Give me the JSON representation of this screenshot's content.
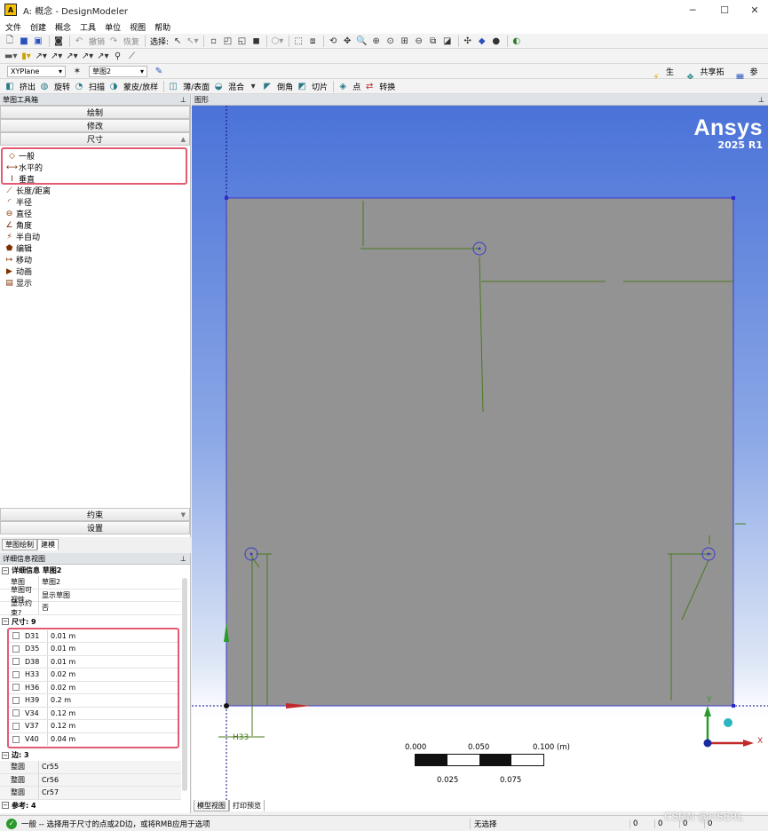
{
  "window": {
    "title": "A: 概念 - DesignModeler",
    "app_icon": "A",
    "minimize": "─",
    "maximize": "☐",
    "close": "✕"
  },
  "menubar": [
    "文件",
    "创建",
    "概念",
    "工具",
    "单位",
    "视图",
    "帮助"
  ],
  "toolbar1": {
    "undo": "撤销",
    "redo": "恢复",
    "select_label": "选择:"
  },
  "toolbar3": {
    "plane": "XYPlane",
    "sketch": "草图2",
    "generate": "生成",
    "share_topology": "共享拓扑",
    "parameters": "参数"
  },
  "toolbar4": {
    "items": [
      "挤出",
      "旋转",
      "扫描",
      "蒙皮/放样",
      "薄/表面",
      "混合",
      "倒角",
      "切片",
      "点",
      "转换"
    ]
  },
  "sketch_toolbox": {
    "title": "草图工具箱",
    "sections": {
      "draw": "绘制",
      "modify": "修改",
      "dimension": "尺寸",
      "constraint": "约束",
      "settings": "设置"
    },
    "tools": [
      "一般",
      "水平的",
      "垂直",
      "长度/距离",
      "半径",
      "直径",
      "角度",
      "半自动",
      "编辑",
      "移动",
      "动画",
      "显示"
    ]
  },
  "tabs": {
    "sketching": "草图绘制",
    "modeling": "建模"
  },
  "details": {
    "title": "详细信息视图",
    "header": "详细信息 草图2",
    "rows": [
      {
        "k": "草图",
        "v": "草图2"
      },
      {
        "k": "草图可视性",
        "v": "显示草图"
      },
      {
        "k": "显示约束?",
        "v": "否"
      }
    ],
    "dims_header": "尺寸: 9",
    "dims": [
      {
        "k": "D31",
        "v": "0.01 m"
      },
      {
        "k": "D35",
        "v": "0.01 m"
      },
      {
        "k": "D38",
        "v": "0.01 m"
      },
      {
        "k": "H33",
        "v": "0.02 m"
      },
      {
        "k": "H36",
        "v": "0.02 m"
      },
      {
        "k": "H39",
        "v": "0.2 m"
      },
      {
        "k": "V34",
        "v": "0.12 m"
      },
      {
        "k": "V37",
        "v": "0.12 m"
      },
      {
        "k": "V40",
        "v": "0.04 m"
      }
    ],
    "edges_header": "边: 3",
    "edges": [
      {
        "k": "整圆",
        "v": "Cr55"
      },
      {
        "k": "整圆",
        "v": "Cr56"
      },
      {
        "k": "整圆",
        "v": "Cr57"
      }
    ],
    "refs_header": "参考: 4"
  },
  "graphics": {
    "title": "图形",
    "brand": "Ansys",
    "version": "2025 R1",
    "dim_label": "H33",
    "scale_top": [
      "0.000",
      "0.050",
      "0.100 (m)"
    ],
    "scale_bottom": [
      "0.025",
      "0.075"
    ],
    "axis_x": "X",
    "axis_y": "Y",
    "tab_model": "模型视图",
    "tab_print": "打印预览"
  },
  "statusbar": {
    "message": "一般 -- 选择用于尺寸的点或2D边，或将RMB应用于选项",
    "selection": "无选择",
    "values": [
      "0",
      "0",
      "0",
      "0"
    ]
  },
  "watermark": "CSDN @HSERL",
  "colors": {
    "viewport_top": "#4a72d8",
    "viewport_bottom": "#ffffff",
    "sketch_face": "#939393",
    "dimension": "#4b7a1f",
    "highlight": "#e25b73"
  }
}
